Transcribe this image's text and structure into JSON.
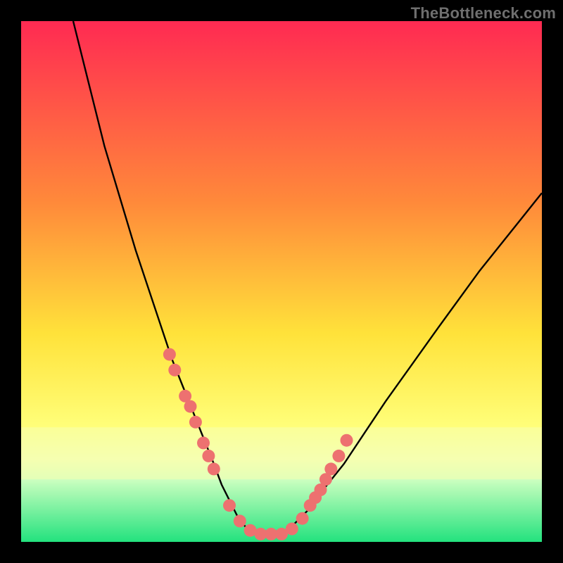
{
  "watermark": "TheBottleneck.com",
  "chart_data": {
    "type": "line",
    "title": "",
    "xlabel": "",
    "ylabel": "",
    "xlim": [
      0,
      100
    ],
    "ylim": [
      0,
      100
    ],
    "grid": false,
    "legend": false,
    "gradient_stops": [
      {
        "offset": 0,
        "color": "#ff2a52"
      },
      {
        "offset": 35,
        "color": "#ff8a3a"
      },
      {
        "offset": 60,
        "color": "#ffe23a"
      },
      {
        "offset": 78,
        "color": "#ffff7a"
      },
      {
        "offset": 84,
        "color": "#f6ffb0"
      },
      {
        "offset": 88,
        "color": "#ccffc0"
      },
      {
        "offset": 100,
        "color": "#23e27e"
      }
    ],
    "band_color": "#f6ffb0",
    "band_y": [
      78,
      88
    ],
    "series": [
      {
        "name": "bottleneck-curve",
        "type": "line",
        "color": "#000000",
        "x": [
          10,
          13,
          16,
          19,
          22,
          25,
          27,
          29,
          31,
          33,
          35,
          37,
          38.5,
          40,
          41.5,
          43,
          45,
          50,
          52,
          55,
          58,
          62,
          66,
          70,
          75,
          80,
          88,
          96,
          100
        ],
        "y": [
          100,
          88,
          76,
          66,
          56,
          47,
          41,
          35,
          30,
          25,
          20,
          15,
          11,
          8,
          5,
          3,
          1.5,
          1.5,
          3,
          6,
          10,
          15,
          21,
          27,
          34,
          41,
          52,
          62,
          67
        ]
      },
      {
        "name": "cluster-markers",
        "type": "scatter",
        "color": "#ed7170",
        "x": [
          28.5,
          29.5,
          31.5,
          32.5,
          33.5,
          35.0,
          36.0,
          37.0,
          40.0,
          42.0,
          44.0,
          46.0,
          48.0,
          50.0,
          52.0,
          54.0,
          55.5,
          56.5,
          57.5,
          58.5,
          59.5,
          61.0,
          62.5
        ],
        "y": [
          36.0,
          33.0,
          28.0,
          26.0,
          23.0,
          19.0,
          16.5,
          14.0,
          7.0,
          4.0,
          2.2,
          1.5,
          1.5,
          1.5,
          2.5,
          4.5,
          7.0,
          8.5,
          10.0,
          12.0,
          14.0,
          16.5,
          19.5
        ]
      }
    ]
  }
}
